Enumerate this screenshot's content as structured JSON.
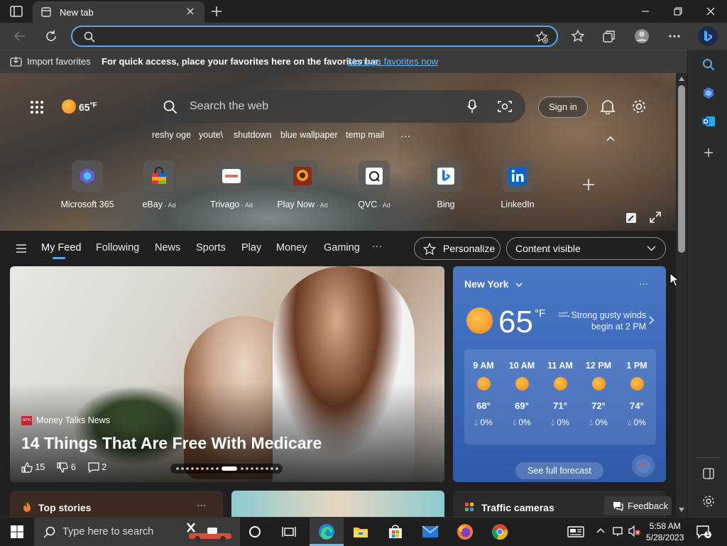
{
  "browser": {
    "tab_title": "New tab",
    "address_value": ""
  },
  "favorites_bar": {
    "import_label": "Import favorites",
    "message": "For quick access, place your favorites here on the favorites bar.",
    "manage_link": "Manage favorites now"
  },
  "header": {
    "temperature": "65",
    "temperature_unit": "°F",
    "search_placeholder": "Search the web",
    "sign_in": "Sign in",
    "recent_searches": [
      "reshy oge",
      "youte\\",
      "shutdown",
      "blue wallpaper",
      "temp mail"
    ]
  },
  "quick_links": [
    {
      "label": "Microsoft 365",
      "ad": "",
      "icon": "microsoft-365-icon"
    },
    {
      "label": "eBay",
      "ad": "Ad",
      "icon": "ebay-icon"
    },
    {
      "label": "Trivago",
      "ad": "Ad",
      "icon": "trivago-icon"
    },
    {
      "label": "Play Now",
      "ad": "Ad",
      "icon": "play-now-icon"
    },
    {
      "label": "QVC",
      "ad": "Ad",
      "icon": "qvc-icon"
    },
    {
      "label": "Bing",
      "ad": "",
      "icon": "bing-icon"
    },
    {
      "label": "LinkedIn",
      "ad": "",
      "icon": "linkedin-icon"
    }
  ],
  "feed_nav": {
    "tabs": [
      "My Feed",
      "Following",
      "News",
      "Sports",
      "Play",
      "Money",
      "Gaming"
    ],
    "active_tab": "My Feed",
    "personalize": "Personalize",
    "content_visible": "Content visible"
  },
  "main_story": {
    "source": "Money Talks News",
    "source_badge": "MTN",
    "headline": "14 Things That Are Free With Medicare",
    "likes": "15",
    "dislikes": "6",
    "comments": "2"
  },
  "weather": {
    "city": "New York",
    "temp": "65",
    "unit": "°F",
    "alert": "Strong gusty winds begin at 2 PM",
    "hourly": [
      {
        "time": "9 AM",
        "temp": "68°",
        "precip": "0%"
      },
      {
        "time": "10 AM",
        "temp": "69°",
        "precip": "0%"
      },
      {
        "time": "11 AM",
        "temp": "71°",
        "precip": "0%"
      },
      {
        "time": "12 PM",
        "temp": "72°",
        "precip": "0%"
      },
      {
        "time": "1 PM",
        "temp": "74°",
        "precip": "0%"
      }
    ],
    "see_full_forecast": "See full forecast"
  },
  "cards": {
    "top_stories": "Top stories",
    "traffic": "Traffic cameras",
    "feedback": "Feedback"
  },
  "taskbar": {
    "search_placeholder": "Type here to search",
    "time": "5:58 AM",
    "date": "5/28/2023",
    "notification_count": "1"
  },
  "colors": {
    "accent": "#5ca8e6",
    "weather_card": "#3967b9",
    "link": "#6fb4f2"
  }
}
